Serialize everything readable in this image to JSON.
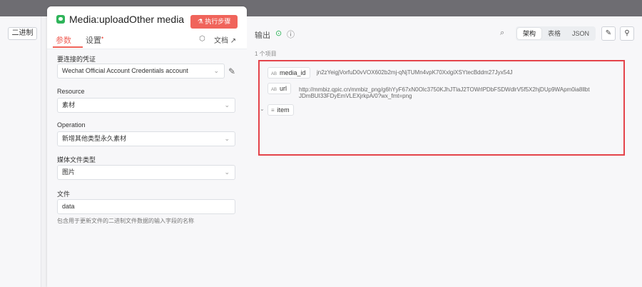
{
  "left": {
    "binary_button": "二进制"
  },
  "node": {
    "title": "Media:uploadOther media",
    "execute_button": "执行步骤",
    "tabs": {
      "params": "参数",
      "settings": "设置",
      "settings_dot": "•"
    },
    "docs_label": "文档",
    "fields": {
      "credential_label": "要连接的凭证",
      "credential_value": "Wechat Official Account Credentials account",
      "resource_label": "Resource",
      "resource_value": "素材",
      "operation_label": "Operation",
      "operation_value": "新增其他类型永久素材",
      "media_type_label": "媒体文件类型",
      "media_type_value": "图片",
      "file_label": "文件",
      "file_value": "data",
      "file_hint": "包含用于更新文件的二进制文件数据的输入字段的名称"
    }
  },
  "output": {
    "title": "输出",
    "count": "1 个项目",
    "view_modes": [
      "架构",
      "表格",
      "JSON"
    ],
    "active_view": "架构",
    "items": [
      {
        "tag": "AB",
        "key": "media_id",
        "value": "jn2zYeigjVorfuD0vVOX602b2mj-qNjTUMn4vpK70XxlgiXSYtecBddm27Jyx54J"
      },
      {
        "tag": "AB",
        "key": "url",
        "value_line1": "http://mmbiz.qpic.cn/mmbiz_png/g6hYyF67xN0Olc3750KJhJTlaJ2TOWrlPDbFSDWdlrV5f5X2hjDUp9WApm0ia8llbt",
        "value_line2": "JDmBUI33FDyEmVLEXjrkpA/0?wx_fmt=png"
      },
      {
        "tag": "≡",
        "key": "item"
      }
    ]
  },
  "colors": {
    "accent": "#f0645b",
    "success": "#2fb45a",
    "highlight_box": "#e4434a"
  }
}
